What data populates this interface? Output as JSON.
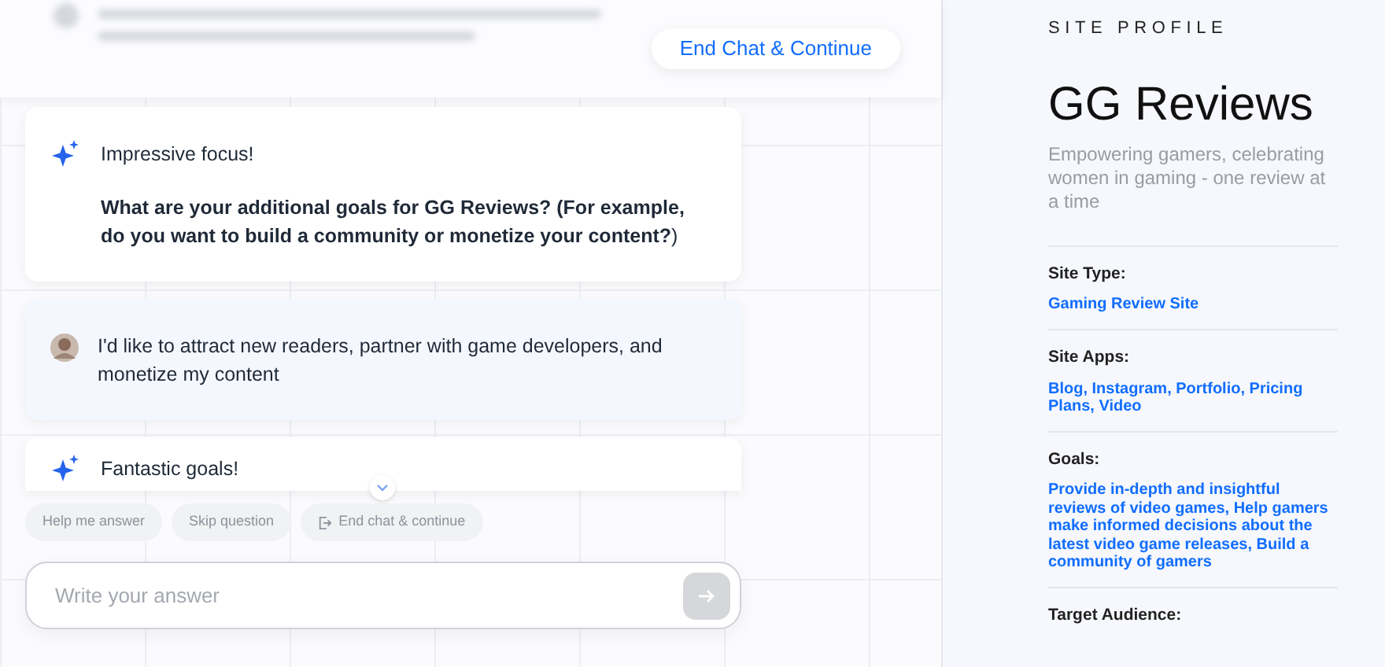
{
  "header": {
    "end_chat_button": "End Chat & Continue"
  },
  "messages": [
    {
      "kind": "assistant",
      "lines": [
        "Impressive focus!",
        "**What are your additional goals for GG Reviews? (For example, do you want to build a community or monetize your content?**)"
      ]
    },
    {
      "kind": "user",
      "lines": [
        "I'd like to attract new readers, partner with game developers, and monetize my content"
      ]
    },
    {
      "kind": "assistant",
      "lines": [
        "Fantastic goals!"
      ]
    }
  ],
  "quick_actions": [
    {
      "label": "Help me answer",
      "kind": "plain",
      "disabled": true
    },
    {
      "label": "Skip question",
      "kind": "plain",
      "disabled": true
    },
    {
      "label": "End chat & continue",
      "kind": "exit",
      "disabled": true
    }
  ],
  "composer": {
    "placeholder": "Write your answer",
    "send_disabled": true
  },
  "profile": {
    "heading": "SITE PROFILE",
    "site_name": "GG Reviews",
    "tagline": "Empowering gamers, celebrating women in gaming - one review at a time",
    "fields": [
      {
        "label": "Site Type:",
        "value": "Gaming Review Site"
      },
      {
        "label": "Site Apps:",
        "value": "Blog, Instagram, Portfolio, Pricing Plans, Video"
      },
      {
        "label": "Goals:",
        "value": "Provide in-depth and insightful reviews of video games, Help gamers make informed decisions about the latest video game releases, Build a community of gamers"
      },
      {
        "label": "Target Audience:"
      }
    ]
  }
}
